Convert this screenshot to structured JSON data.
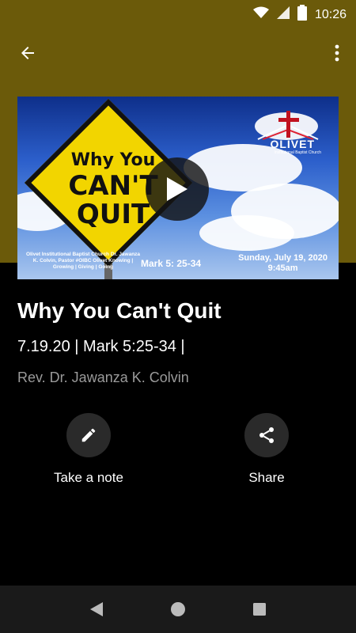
{
  "status_bar": {
    "time": "10:26",
    "icons": [
      "wifi-icon",
      "signal-icon",
      "battery-icon"
    ]
  },
  "toolbar": {
    "back_icon": "arrow-left-icon",
    "more_icon": "more-vertical-icon"
  },
  "hero": {
    "sign_line1": "Why You",
    "sign_line2": "CAN'T",
    "sign_line3": "QUIT",
    "logo_name": "OLIVET",
    "logo_sub": "Institutional Baptist Church",
    "church_info": "Olivet Institutional Baptist Church Dr. Jawanza K. Colvin, Pastor #OIBC Olivet Knowing | Growing | Giving | Going",
    "scripture": "Mark 5: 25-34",
    "date": "Sunday, July 19, 2020",
    "time": "9:45am",
    "play_icon": "play-icon"
  },
  "sermon": {
    "title": "Why You Can't Quit",
    "subtitle": "7.19.20 | Mark 5:25-34 |",
    "speaker": "Rev. Dr. Jawanza K. Colvin"
  },
  "actions": {
    "note_label": "Take a note",
    "note_icon": "pencil-icon",
    "share_label": "Share",
    "share_icon": "share-icon"
  },
  "nav": {
    "icons": [
      "back-triangle-icon",
      "home-circle-icon",
      "recents-square-icon"
    ]
  },
  "colors": {
    "header": "#6b5a0a",
    "background": "#000000",
    "sign": "#f2d500",
    "speaker_text": "#9a9a9a"
  }
}
